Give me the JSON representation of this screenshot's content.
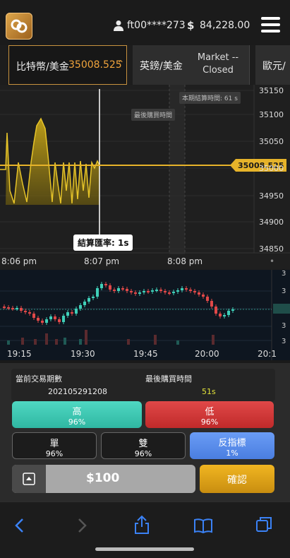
{
  "header": {
    "logo_icon": "logo-icon",
    "username": "ft00****273",
    "currency_symbol": "$",
    "balance": "84,228.00"
  },
  "pairs": [
    {
      "name": "比特幣/美金",
      "price": "35008.525",
      "arrow": "≈",
      "active": true
    },
    {
      "name": "英鎊/美金",
      "status_line1": "Market --",
      "status_line2": "Closed"
    },
    {
      "name": "歐元/"
    }
  ],
  "main_chart": {
    "y_ticks": [
      "35150",
      "35100",
      "35050",
      "35000",
      "34950",
      "34900",
      "34850"
    ],
    "x_ticks": [
      "8:06 pm",
      "8:07 pm",
      "8:08 pm"
    ],
    "current_price": "35008.525",
    "label_period_end": "本期結算時間: 61 s",
    "label_last_purchase": "最後購買時間",
    "settlement_rate": "結算匯率: 1s",
    "color_line": "#d8b317",
    "color_current": "#e6b32a"
  },
  "sub_chart": {
    "x_ticks": [
      "19:15",
      "19:30",
      "19:45",
      "20:00",
      "20:1"
    ],
    "y_ticks": [
      "3",
      "3",
      "3",
      "3",
      "3"
    ]
  },
  "panel": {
    "period_label": "當前交易期數",
    "period_value": "202105291208",
    "last_buy_label": "最後購買時間",
    "last_buy_value": "51s",
    "high": {
      "label": "高",
      "pct": "96%"
    },
    "low": {
      "label": "低",
      "pct": "96%"
    },
    "odd": {
      "label": "單",
      "pct": "96%"
    },
    "even": {
      "label": "雙",
      "pct": "96%"
    },
    "reverse": {
      "label": "反指標",
      "pct": "1%"
    },
    "amount": "$100",
    "confirm": "確認",
    "colors": {
      "high": "#3fcfb8",
      "low": "#d93a3a",
      "reverse": "#5b8ff0",
      "confirm": "#d9a11c"
    }
  },
  "safari": {
    "icons": [
      "back-icon",
      "forward-icon",
      "share-icon",
      "bookmarks-icon",
      "tabs-icon"
    ]
  }
}
